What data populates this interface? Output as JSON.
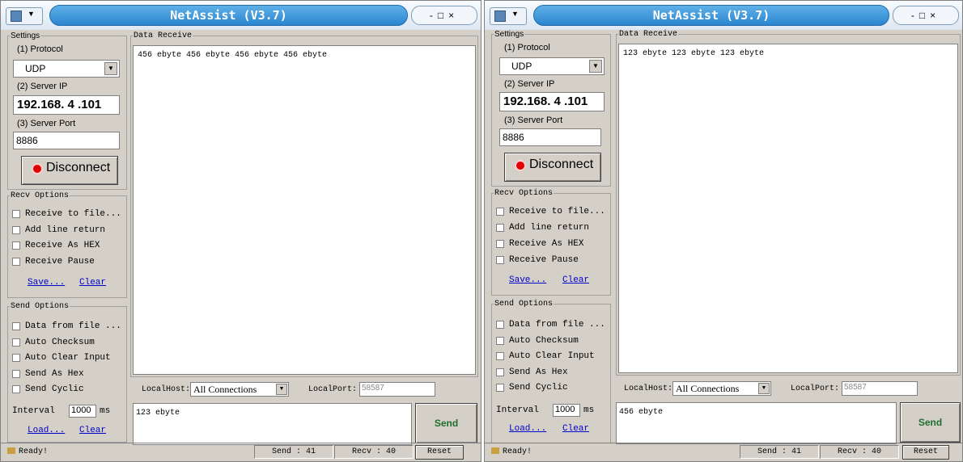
{
  "windows": [
    {
      "title": "NetAssist (V3.7)",
      "settings": {
        "legend": "Settings",
        "protocol_label": "(1) Protocol",
        "protocol_value": "UDP",
        "server_ip_label": "(2) Server IP",
        "server_ip_value": "192.168. 4 .101",
        "server_port_label": "(3) Server Port",
        "server_port_value": "8886",
        "connect_button": "Disconnect"
      },
      "recv_options": {
        "legend": "Recv Options",
        "items": [
          "Receive to file...",
          "Add line return",
          "Receive As HEX",
          "Receive Pause"
        ],
        "save_link": "Save...",
        "clear_link": "Clear"
      },
      "send_options": {
        "legend": "Send Options",
        "items": [
          "Data from file ...",
          "Auto Checksum",
          "Auto Clear Input",
          "Send As Hex",
          "Send Cyclic"
        ],
        "interval_label": "Interval",
        "interval_value": "1000",
        "interval_unit": "ms",
        "load_link": "Load...",
        "clear_link": "Clear"
      },
      "data_receive": {
        "legend": "Data Receive",
        "content": "456 ebyte 456 ebyte 456 ebyte 456 ebyte"
      },
      "local": {
        "host_label": "LocalHost:",
        "host_value": "All Connections",
        "port_label": "LocalPort:",
        "port_value": "58587"
      },
      "send_text": "123 ebyte",
      "send_button": "Send",
      "status": {
        "ready": "Ready!",
        "send": "Send : 41",
        "recv": "Recv : 40",
        "reset": "Reset"
      }
    },
    {
      "title": "NetAssist (V3.7)",
      "settings": {
        "legend": "Settings",
        "protocol_label": "(1) Protocol",
        "protocol_value": "UDP",
        "server_ip_label": "(2) Server IP",
        "server_ip_value": "192.168. 4 .101",
        "server_port_label": "(3) Server Port",
        "server_port_value": "8886",
        "connect_button": "Disconnect"
      },
      "recv_options": {
        "legend": "Recv Options",
        "items": [
          "Receive to file...",
          "Add line return",
          "Receive As HEX",
          "Receive Pause"
        ],
        "save_link": "Save...",
        "clear_link": "Clear"
      },
      "send_options": {
        "legend": "Send Options",
        "items": [
          "Data from file ...",
          "Auto Checksum",
          "Auto Clear Input",
          "Send As Hex",
          "Send Cyclic"
        ],
        "interval_label": "Interval",
        "interval_value": "1000",
        "interval_unit": "ms",
        "load_link": "Load...",
        "clear_link": "Clear"
      },
      "data_receive": {
        "legend": "Data Receive",
        "content": "123 ebyte 123 ebyte 123 ebyte"
      },
      "local": {
        "host_label": "LocalHost:",
        "host_value": "All Connections",
        "port_label": "LocalPort:",
        "port_value": "58587"
      },
      "send_text": "456 ebyte",
      "send_button": "Send",
      "status": {
        "ready": "Ready!",
        "send": "Send : 41",
        "recv": "Recv : 40",
        "reset": "Reset"
      }
    }
  ]
}
